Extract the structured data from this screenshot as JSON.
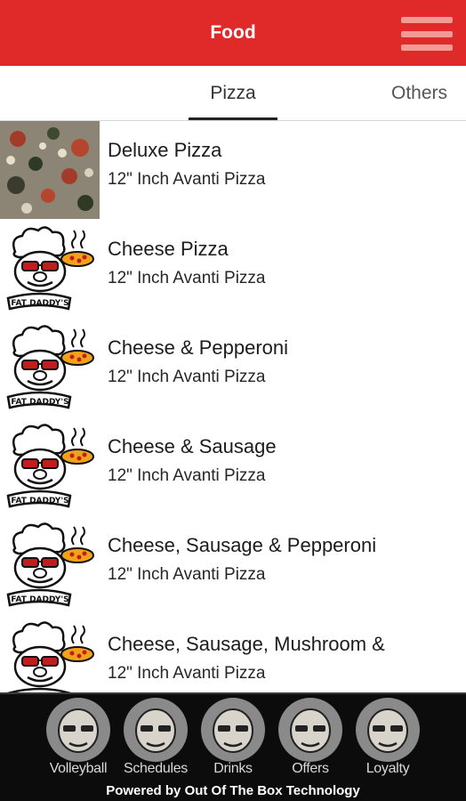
{
  "app_bar": {
    "title": "Food",
    "menu_icon": "hamburger-menu-icon"
  },
  "tabs": [
    {
      "label": "Pizza",
      "selected": true
    },
    {
      "label": "Others",
      "selected": false
    }
  ],
  "menu_items": [
    {
      "title": "Deluxe Pizza",
      "subtitle": "12\" Inch Avanti Pizza",
      "thumbnail": "pizza-photo"
    },
    {
      "title": "Cheese Pizza",
      "subtitle": "12\" Inch Avanti Pizza",
      "thumbnail": "fat-daddys-logo"
    },
    {
      "title": "Cheese & Pepperoni",
      "subtitle": "12\" Inch Avanti Pizza",
      "thumbnail": "fat-daddys-logo"
    },
    {
      "title": "Cheese & Sausage",
      "subtitle": "12\" Inch Avanti Pizza",
      "thumbnail": "fat-daddys-logo"
    },
    {
      "title": "Cheese, Sausage & Pepperoni",
      "subtitle": "12\" Inch Avanti Pizza",
      "thumbnail": "fat-daddys-logo"
    },
    {
      "title": "Cheese, Sausage, Mushroom &",
      "subtitle": "12\" Inch Avanti Pizza",
      "thumbnail": "fat-daddys-logo"
    }
  ],
  "bottom_nav": [
    {
      "label": "Volleyball",
      "icon": "volleyball-caricature-icon"
    },
    {
      "label": "Schedules",
      "icon": "schedules-caricature-icon"
    },
    {
      "label": "Drinks",
      "icon": "drinks-caricature-icon"
    },
    {
      "label": "Offers",
      "icon": "offers-caricature-icon"
    },
    {
      "label": "Loyalty",
      "icon": "loyalty-caricature-icon"
    }
  ],
  "footer": {
    "powered_by": "Powered by Out Of The Box Technology"
  },
  "colors": {
    "app_bar": "#e02a2a",
    "menu_icon": "#f39a96",
    "bottom_bar": "#0c0c0c"
  }
}
